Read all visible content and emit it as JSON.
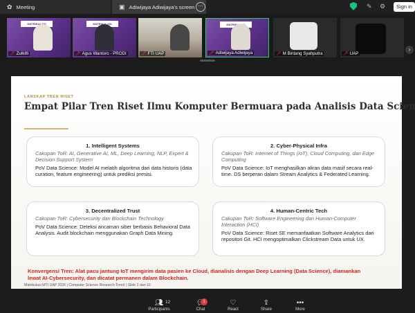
{
  "window": {
    "tab_meeting": "Meeting",
    "tab_screen": "Adiwijaya Adiwijaya's screen",
    "sign_in": "Sign in"
  },
  "participants_strip": [
    {
      "name": "Zulkifli",
      "muted": true
    },
    {
      "name": "Agus Wantoro - PRODI",
      "muted": true
    },
    {
      "name": "FTI UAP",
      "muted": true
    },
    {
      "name": "Adiwijaya Adiwijaya",
      "muted": true
    },
    {
      "name": "M Bintang Syahputra",
      "muted": true
    },
    {
      "name": "UAP",
      "muted": true
    }
  ],
  "slide_banner": "MATRIKULASI",
  "slide": {
    "overline": "LANSKAP TREN RISET",
    "title": "Empat Pilar Tren Riset Ilmu Komputer Bermuara pada Analisis Data Science",
    "cards": [
      {
        "title": "1. Intelligent Systems",
        "scope": "Cakupan ToR: AI, Generative AI, ML, Deep Learning, NLP, Expert & Decision Support System",
        "pov": "PoV Data Science: Model AI melatih algoritma dari data historis (data curation, feature engineering) untuk prediksi presisi."
      },
      {
        "title": "2. Cyber-Physical Infra",
        "scope": "Cakupan ToR: Internet of Things (IoT), Cloud Computing, dan Edge Computing",
        "pov": "PoV Data Science: IoT menghasilkan aliran data masif secara real-time. DS berperan dalam Stream Analytics & Federated Learning."
      },
      {
        "title": "3. Decentralized Trust",
        "scope": "Cakupan ToR: Cybersecurity dan Blockchain Technology",
        "pov": "PoV Data Science: Deteksi ancaman siber berbasis Behavioral Data Analysis. Audit blockchain menggunakan Graph Data Mining."
      },
      {
        "title": "4. Human-Centric Tech",
        "scope": "Cakupan ToR: Software Engineering dan Human-Computer Interaction (HCI)",
        "pov": "PoV Data Science: Riset SE memanfaatkan Software Analytics dari repositori Git. HCI mengoptimalkan Clickstream Data untuk UX."
      }
    ],
    "konvergensi": "Konvergensi Tren: Alat pacu jantung IoT mengirim data pasien ke Cloud, dianalisis dengan Deep Learning (Data Science), diamankan lewat AI-Cybersecurity, dan dicatat permanen dalam Blockchain.",
    "footer": "Matrikulasi MTI UAP 2026  |  Computer Science Research Trend  |  Slide 2 dari 10"
  },
  "toolbar": {
    "participants_count": "12",
    "chat_badge": "1",
    "items": [
      "Participants",
      "Chat",
      "React",
      "Share",
      "More"
    ]
  },
  "colors": {
    "accent_gold": "#b08a3c",
    "title_text": "#2d2d2d",
    "konvergensi_red": "#c8261e",
    "shield_green": "#19c37d",
    "mute_red": "#ff3b30"
  }
}
